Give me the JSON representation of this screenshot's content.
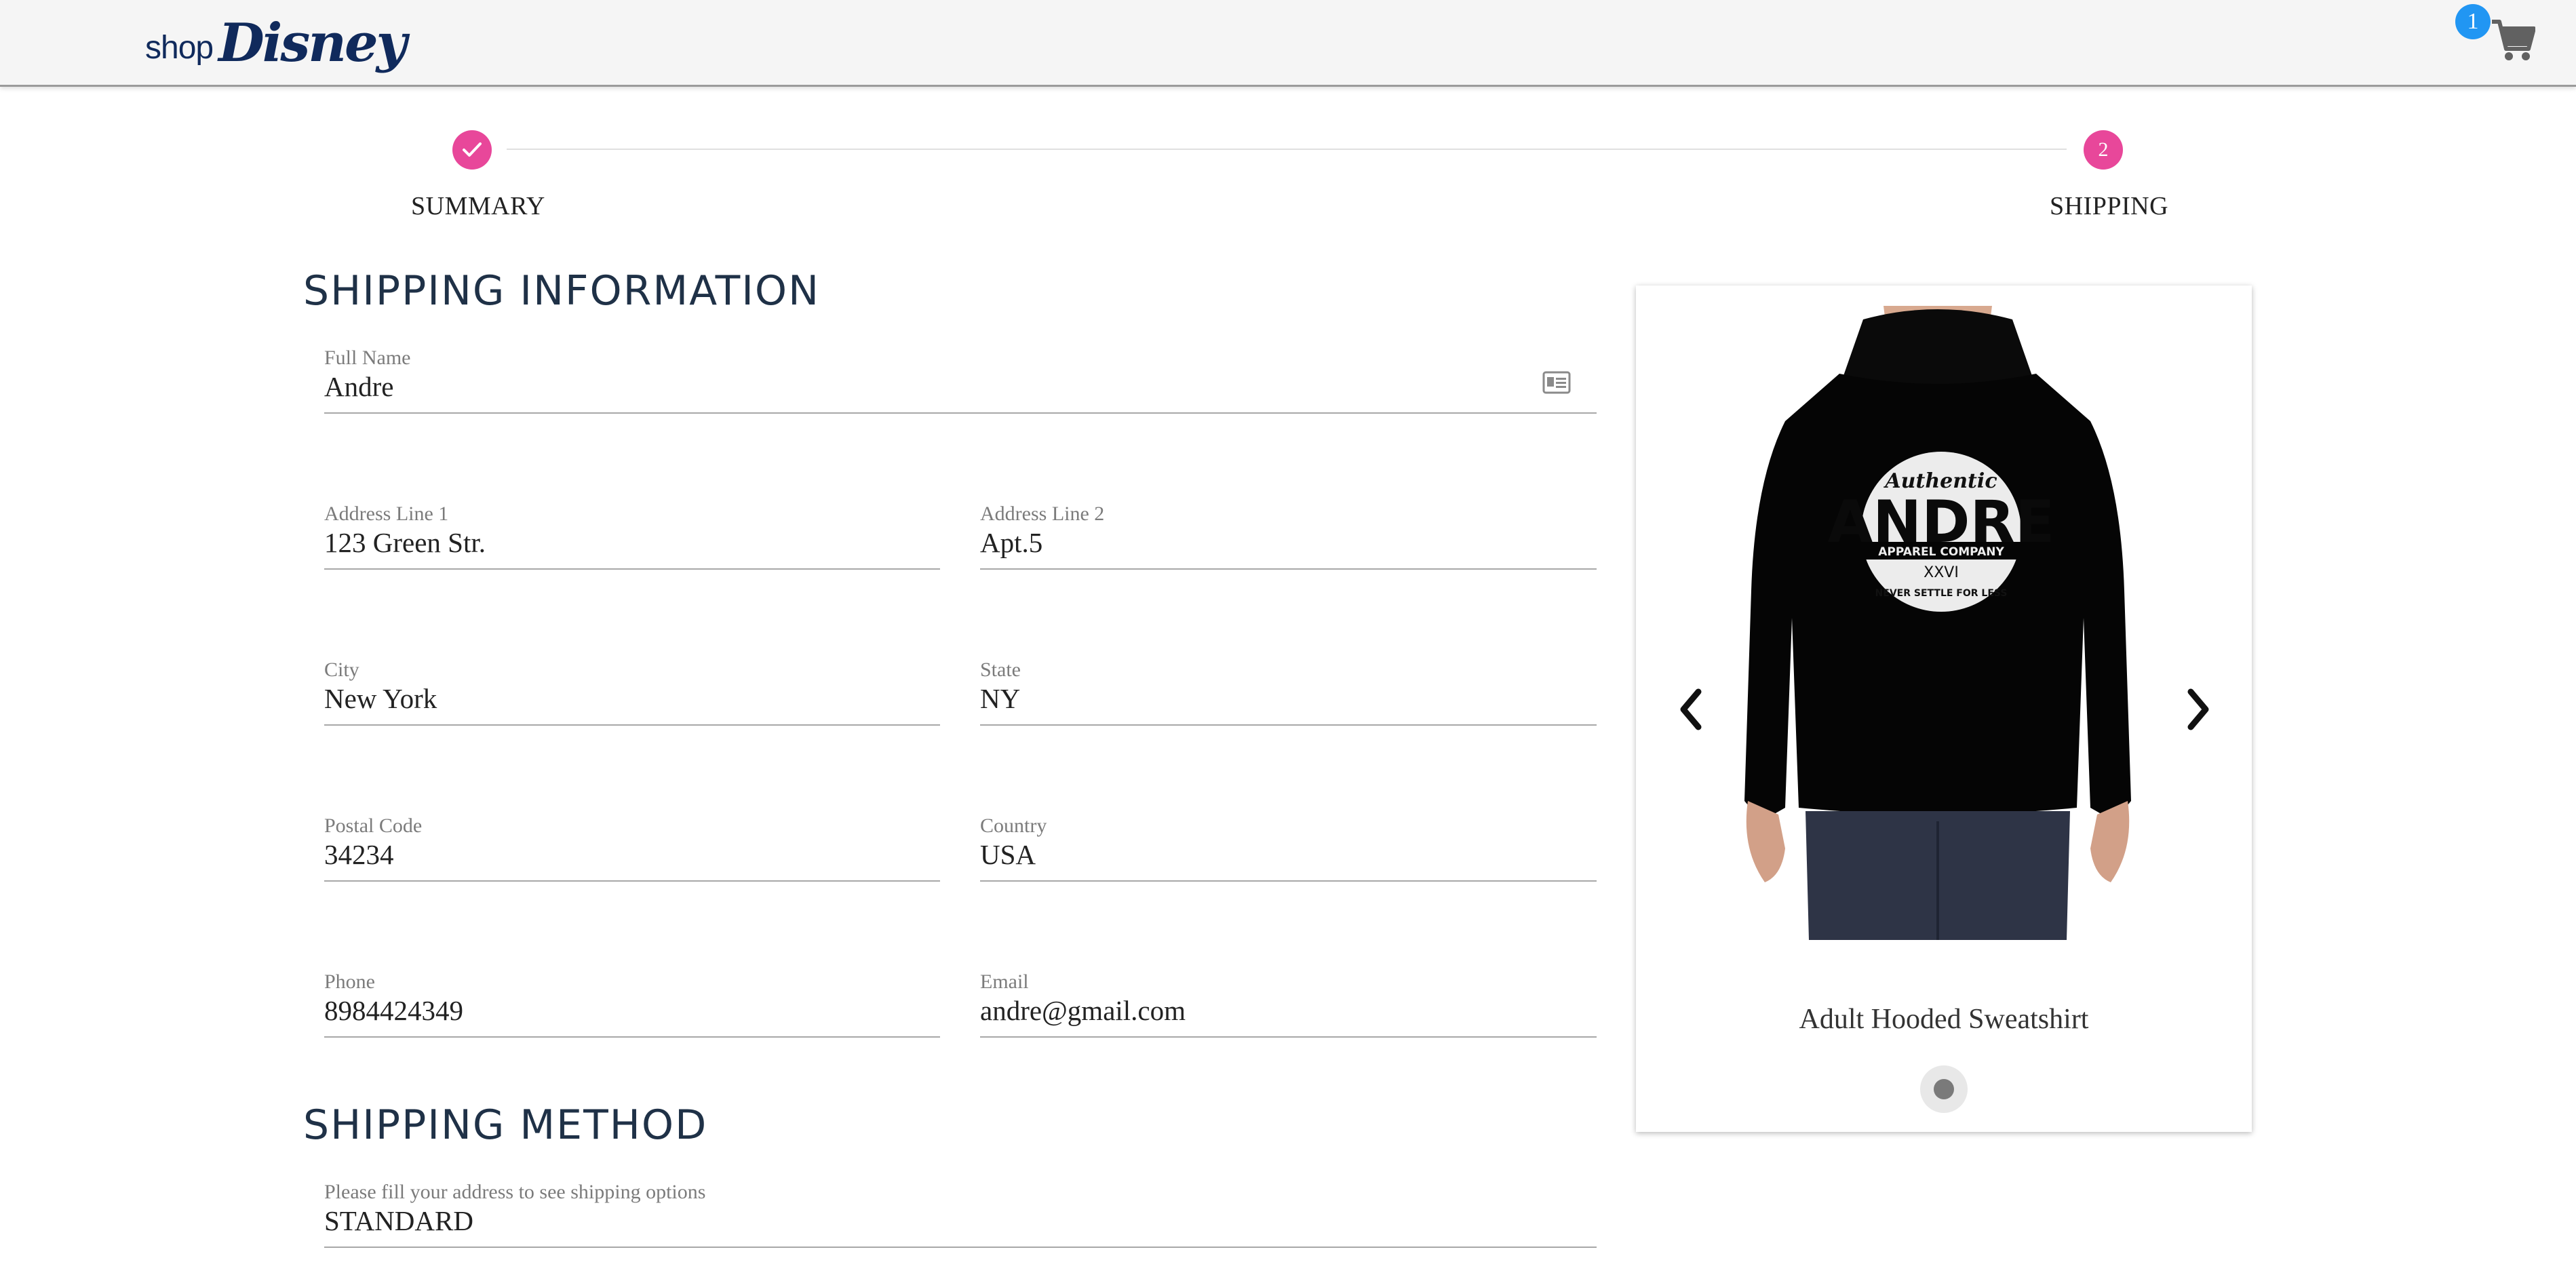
{
  "header": {
    "logo_shop": "shop",
    "logo_disney": "Disney",
    "cart_count": "1",
    "cart_icon": "shopping-cart-icon"
  },
  "stepper": {
    "steps": [
      {
        "label": "SUMMARY",
        "state": "completed",
        "icon": "check-icon"
      },
      {
        "label": "SHIPPING",
        "number": "2",
        "state": "active"
      }
    ],
    "accent": "#e8479a"
  },
  "shipping_info": {
    "title": "SHIPPING INFORMATION",
    "full_name": {
      "label": "Full Name",
      "value": "Andre"
    },
    "address1": {
      "label": "Address Line 1",
      "value": "123 Green Str."
    },
    "address2": {
      "label": "Address Line 2",
      "value": "Apt.5"
    },
    "city": {
      "label": "City",
      "value": "New York"
    },
    "state": {
      "label": "State",
      "value": "NY"
    },
    "postal": {
      "label": "Postal Code",
      "value": "34234"
    },
    "country": {
      "label": "Country",
      "value": "USA"
    },
    "phone": {
      "label": "Phone",
      "value": "8984424349"
    },
    "email": {
      "label": "Email",
      "value": "andre@gmail.com"
    }
  },
  "shipping_method": {
    "title": "SHIPPING METHOD",
    "label": "Please fill your address to see shipping options",
    "value": "STANDARD"
  },
  "product": {
    "name": "Adult Hooded Sweatshirt",
    "print_top": "Authentic",
    "print_main": "ANDRE",
    "print_sub": "APPAREL COMPANY",
    "print_num": "XXVI",
    "print_bottom": "NEVER SETTLE FOR LESS",
    "carousel_index": 1,
    "carousel_total": 1
  },
  "colors": {
    "accent_pink": "#e8479a",
    "badge_blue": "#2196f3",
    "title_navy": "#1f3147"
  }
}
